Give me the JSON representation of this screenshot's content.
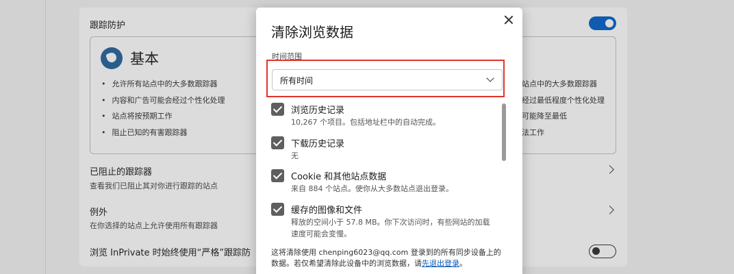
{
  "background": {
    "section_title": "跟踪防护",
    "basic": {
      "title": "基本",
      "bullets": [
        "允许所有站点中的大多数跟踪器",
        "内容和广告可能会经过个性化处理",
        "站点将按预期工作",
        "阻止已知的有害跟踪器"
      ],
      "right_bullets": [
        "站点中的大多数跟踪器",
        "经过最低程度个性化处理",
        "可能降至最低",
        "法工作",
        "害跟踪器"
      ]
    },
    "blocked": {
      "title": "已阻止的跟踪器",
      "subtitle": "查看我们已阻止其对你进行跟踪的站点"
    },
    "exceptions": {
      "title": "例外",
      "subtitle": "在你选择的站点上允许使用所有跟踪器"
    },
    "inprivate": {
      "title": "浏览 InPrivate 时始终使用“严格”跟踪防"
    }
  },
  "dialog": {
    "title": "清除浏览数据",
    "range_label": "时间范围",
    "range_value": "所有时间",
    "items": [
      {
        "title": "浏览历史记录",
        "subtitle": "10,267 个项目。包括地址栏中的自动完成。",
        "checked": true
      },
      {
        "title": "下载历史记录",
        "subtitle": "无",
        "checked": true
      },
      {
        "title": "Cookie 和其他站点数据",
        "subtitle": "来自 884 个站点。使你从大多数站点退出登录。",
        "checked": true
      },
      {
        "title": "缓存的图像和文件",
        "subtitle": "释放的空间小于 57.8 MB。你下次访问时，有些网站的加载速度可能会变慢。",
        "checked": true
      }
    ],
    "footer": {
      "text_before": "这将清除使用 chenping6023@qq.com 登录到的所有同步设备上的数据。若仅希望清除此设备中的浏览数据，请",
      "link": "先退出登录",
      "text_after": "。"
    }
  },
  "colors": {
    "toggle_on": "#0f5bb0",
    "highlight": "#e0342b",
    "link": "#0a58b3"
  }
}
